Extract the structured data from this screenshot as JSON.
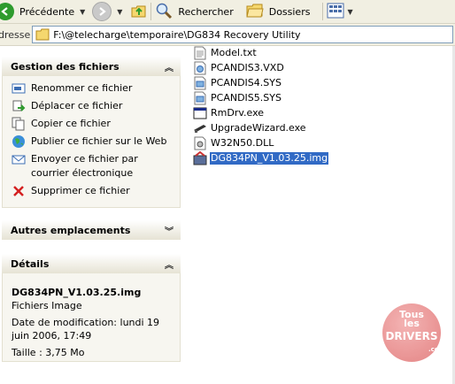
{
  "toolbar": {
    "back_label": "Précédente",
    "search_label": "Rechercher",
    "folders_label": "Dossiers"
  },
  "address": {
    "label": "dresse",
    "path": "F:\\@telecharge\\temporaire\\DG834 Recovery Utility"
  },
  "tasks_panel": {
    "title": "Gestion des fichiers",
    "items": [
      {
        "label": "Renommer ce fichier",
        "icon": "rename-icon"
      },
      {
        "label": "Déplacer ce fichier",
        "icon": "move-icon"
      },
      {
        "label": "Copier ce fichier",
        "icon": "copy-icon"
      },
      {
        "label": "Publier ce fichier sur le Web",
        "icon": "globe-icon"
      },
      {
        "label": "Envoyer ce fichier par courrier électronique",
        "icon": "mail-icon"
      },
      {
        "label": "Supprimer ce fichier",
        "icon": "delete-icon"
      }
    ]
  },
  "places_panel": {
    "title": "Autres emplacements"
  },
  "details_panel": {
    "title": "Détails",
    "file_name": "DG834PN_V1.03.25.img",
    "file_type": "Fichiers Image",
    "modified": "Date de modification: lundi 19 juin 2006, 17:49",
    "size": "Taille : 3,75 Mo"
  },
  "files": [
    {
      "name": "Model.txt",
      "icon": "text-file-icon",
      "selected": false
    },
    {
      "name": "PCANDIS3.VXD",
      "icon": "system-file-icon",
      "selected": false
    },
    {
      "name": "PCANDIS4.SYS",
      "icon": "system-file-icon",
      "selected": false
    },
    {
      "name": "PCANDIS5.SYS",
      "icon": "system-file-icon",
      "selected": false
    },
    {
      "name": "RmDrv.exe",
      "icon": "exe-file-icon",
      "selected": false
    },
    {
      "name": "UpgradeWizard.exe",
      "icon": "exe-file-icon",
      "selected": false
    },
    {
      "name": "W32N50.DLL",
      "icon": "dll-file-icon",
      "selected": false
    },
    {
      "name": "DG834PN_V1.03.25.img",
      "icon": "image-file-icon",
      "selected": true
    }
  ],
  "watermark": {
    "line1": "Tous",
    "line2": "les",
    "line3": "DRIVERS",
    "line4": ".com"
  }
}
